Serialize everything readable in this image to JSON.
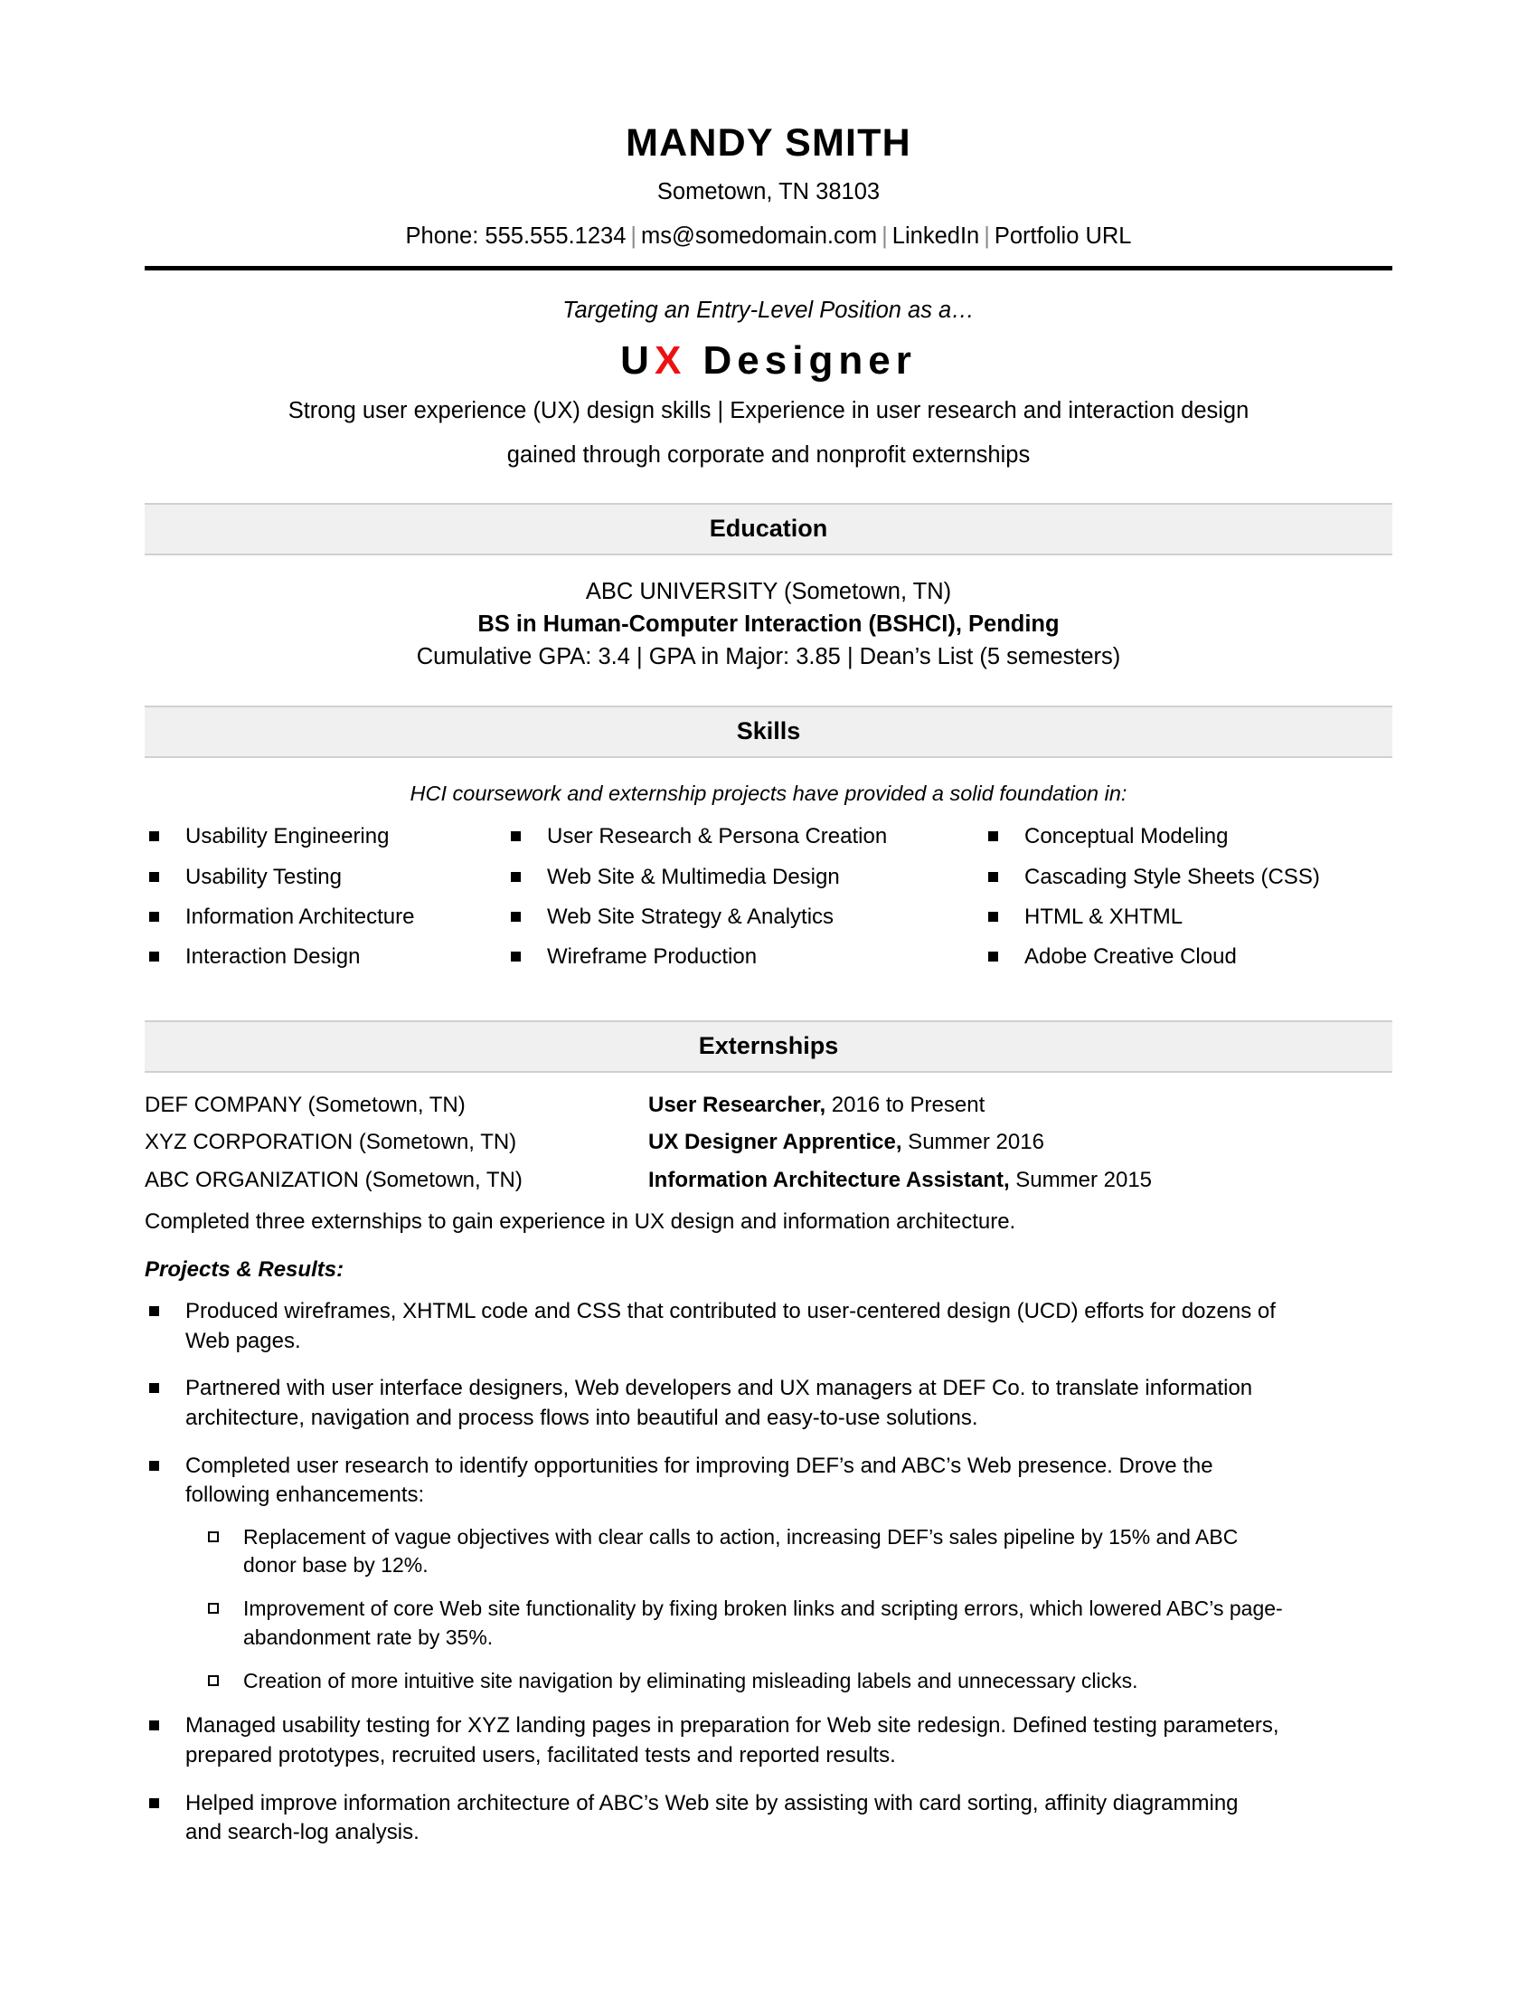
{
  "header": {
    "name": "MANDY SMITH",
    "location": "Sometown, TN 38103",
    "phone": "Phone: 555.555.1234",
    "email": "ms@somedomain.com",
    "linkedin": "LinkedIn",
    "portfolio": "Portfolio URL",
    "separator": "|"
  },
  "headline": {
    "targeting": "Targeting an Entry-Level Position as a…",
    "title_u": "U",
    "title_x": "X",
    "title_rest": "Designer",
    "summary_line1": "Strong user experience (UX) design skills | Experience in user research and interaction design",
    "summary_line2": "gained through corporate and nonprofit externships"
  },
  "education": {
    "section_title": "Education",
    "school": "ABC UNIVERSITY (Sometown, TN)",
    "degree": "BS in Human-Computer Interaction (BSHCI), Pending",
    "gpa": "Cumulative GPA: 3.4 | GPA in Major: 3.85 | Dean’s List (5 semesters)"
  },
  "skills": {
    "section_title": "Skills",
    "intro": "HCI coursework and externship projects have provided a solid foundation in:",
    "column1": [
      "Usability Engineering",
      "Usability Testing",
      "Information Architecture",
      "Interaction Design"
    ],
    "column2": [
      "User Research & Persona Creation",
      "Web Site & Multimedia Design",
      "Web Site Strategy & Analytics",
      "Wireframe Production"
    ],
    "column3": [
      "Conceptual Modeling",
      "Cascading Style Sheets (CSS)",
      "HTML & XHTML",
      "Adobe Creative Cloud"
    ]
  },
  "externships": {
    "section_title": "Externships",
    "rows": [
      {
        "company": "DEF COMPANY (Sometown, TN)",
        "role": "User Researcher,",
        "dates": " 2016 to Present"
      },
      {
        "company": "XYZ CORPORATION (Sometown, TN)",
        "role": "UX Designer Apprentice,",
        "dates": " Summer 2016"
      },
      {
        "company": "ABC ORGANIZATION (Sometown, TN)",
        "role": "Information Architecture Assistant,",
        "dates": " Summer 2015"
      }
    ],
    "note": "Completed three externships to gain experience in UX design and information architecture.",
    "projects_label": "Projects & Results:",
    "bullets": [
      "Produced wireframes, XHTML code and CSS that contributed to user-centered design (UCD) efforts for dozens of Web pages.",
      "Partnered with user interface designers, Web developers and UX managers at DEF Co. to translate information architecture, navigation and process flows into beautiful and easy-to-use solutions.",
      "Completed user research to identify opportunities for improving DEF’s and ABC’s Web presence. Drove the following enhancements:"
    ],
    "subbullets": [
      "Replacement of vague objectives with clear calls to action, increasing DEF’s sales pipeline by 15% and ABC donor base by 12%.",
      "Improvement of core Web site functionality by fixing broken links and scripting errors, which lowered ABC’s page-abandonment rate by 35%.",
      "Creation of more intuitive site navigation by eliminating misleading labels and unnecessary clicks."
    ],
    "bullets_after": [
      "Managed usability testing for XYZ landing pages in preparation for Web site redesign. Defined testing parameters, prepared prototypes, recruited users, facilitated tests and reported results.",
      "Helped improve information architecture of ABC’s Web site by assisting with card sorting, affinity diagramming and search-log analysis."
    ]
  },
  "colors": {
    "accent_red": "#ee1111",
    "section_bar_bg": "#f0f0f0",
    "section_bar_border": "#d0d0d0",
    "text": "#000000"
  }
}
